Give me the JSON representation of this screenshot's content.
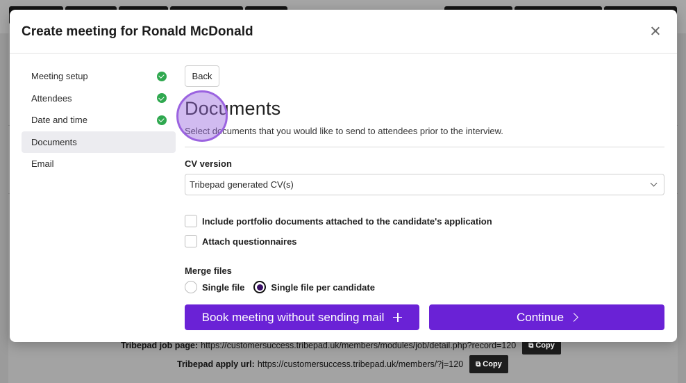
{
  "background": {
    "footer": {
      "job_page_label": "Tribepad job page:",
      "job_page_url": "https://customersuccess.tribepad.uk/members/modules/job/detail.php?record=120",
      "apply_url_label": "Tribepad apply url:",
      "apply_url": "https://customersuccess.tribepad.uk/members/?j=120",
      "copy_label": "Copy"
    }
  },
  "modal": {
    "title": "Create meeting for Ronald McDonald",
    "steps": [
      {
        "label": "Meeting setup",
        "completed": true
      },
      {
        "label": "Attendees",
        "completed": true
      },
      {
        "label": "Date and time",
        "completed": true
      },
      {
        "label": "Documents",
        "completed": false,
        "active": true
      },
      {
        "label": "Email",
        "completed": false
      }
    ],
    "back_label": "Back",
    "section_title": "Documents",
    "section_description": "Select documents that you would like to send to attendees prior to the interview.",
    "cv_version": {
      "label": "CV version",
      "selected": "Tribepad generated CV(s)"
    },
    "checkboxes": [
      {
        "label": "Include portfolio documents attached to the candidate's application",
        "checked": false
      },
      {
        "label": "Attach questionnaires",
        "checked": false
      }
    ],
    "merge_files": {
      "label": "Merge files",
      "options": [
        {
          "label": "Single file",
          "selected": false
        },
        {
          "label": "Single file per candidate",
          "selected": true
        }
      ]
    },
    "buttons": {
      "book_without_mail": "Book meeting without sending mail",
      "continue": "Continue"
    }
  },
  "colors": {
    "primary": "#6a22d6",
    "success": "#2fa84f",
    "highlight": "#9b63e0"
  }
}
